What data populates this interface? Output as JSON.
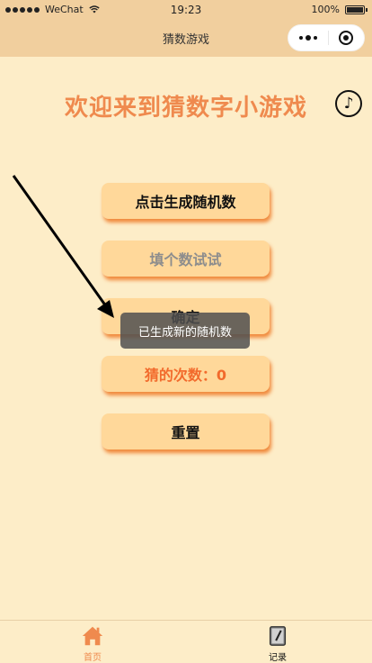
{
  "status_bar": {
    "carrier": "WeChat",
    "time": "19:23",
    "battery": "100%"
  },
  "nav": {
    "title": "猜数游戏"
  },
  "page": {
    "title": "欢迎来到猜数字小游戏",
    "music_icon": "♪"
  },
  "buttons": {
    "generate": "点击生成随机数",
    "input_placeholder": "填个数试试",
    "confirm": "确定",
    "guess_count": "猜的次数：0",
    "reset": "重置"
  },
  "toast": {
    "text": "已生成新的随机数"
  },
  "tabbar": {
    "home_label": "首页",
    "record_label": "记录"
  }
}
